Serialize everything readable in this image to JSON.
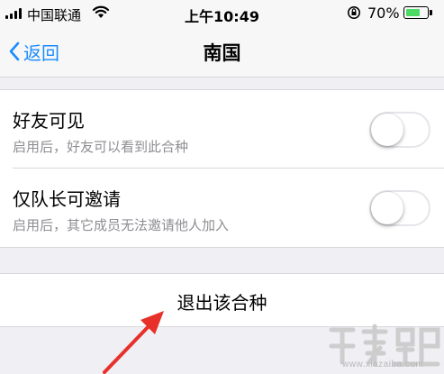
{
  "status_bar": {
    "carrier": "中国联通",
    "time": "上午10:49",
    "battery_percent": "70%",
    "battery_level": 0.7,
    "icons": [
      "signal-icon",
      "wifi-icon",
      "orientation-lock-icon",
      "battery-icon"
    ]
  },
  "nav": {
    "back_label": "返回",
    "title": "南国"
  },
  "settings": [
    {
      "title": "好友可见",
      "subtitle": "启用后，好友可以看到此合种",
      "enabled": false
    },
    {
      "title": "仅队长可邀请",
      "subtitle": "启用后，其它成员无法邀请他人加入",
      "enabled": false
    }
  ],
  "exit_label": "退出该合种",
  "watermark": {
    "text": "www.xiazaiba.com"
  },
  "colors": {
    "accent": "#1a8cff",
    "battery": "#4cd964",
    "arrow": "#e8302a",
    "background": "#efeff4"
  }
}
